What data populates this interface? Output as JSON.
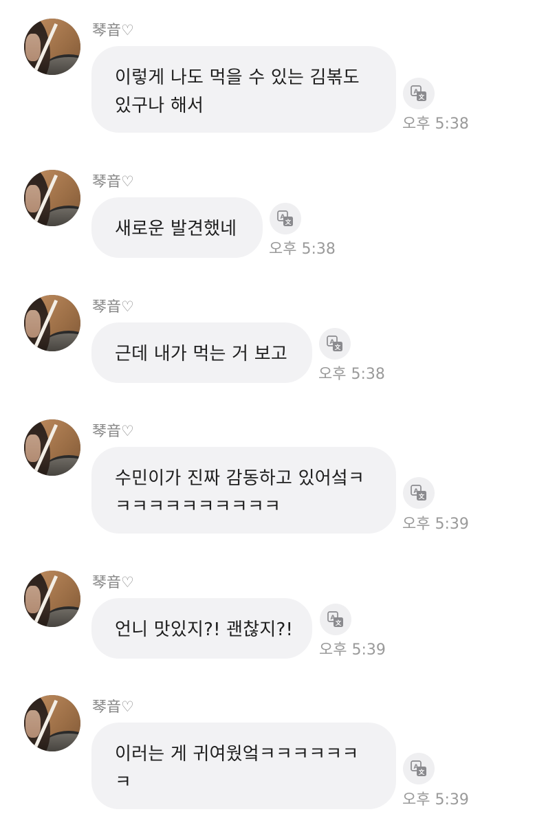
{
  "messages": [
    {
      "sender": "琴音♡",
      "lines": [
        "이렇게 나도 먹을 수 있는 김볶도",
        "있구나 해서"
      ],
      "time": "오후 5:38"
    },
    {
      "sender": "琴音♡",
      "lines": [
        "새로운 발견했네"
      ],
      "time": "오후 5:38"
    },
    {
      "sender": "琴音♡",
      "lines": [
        "근데 내가 먹는 거 보고"
      ],
      "time": "오후 5:38"
    },
    {
      "sender": "琴音♡",
      "lines": [
        "수민이가 진짜 감동하고 있어섴ㅋ",
        "ㅋㅋㅋㅋㅋㅋㅋㅋㅋㅋ"
      ],
      "time": "오후 5:39"
    },
    {
      "sender": "琴音♡",
      "lines": [
        "언니 맛있지?! 괜찮지?!"
      ],
      "time": "오후 5:39"
    },
    {
      "sender": "琴音♡",
      "lines": [
        "이러는 게 귀여웠엌ㅋㅋㅋㅋㅋㅋ",
        "ㅋ"
      ],
      "time": "오후 5:39"
    }
  ],
  "icons": {
    "translate": "translate-icon",
    "avatar": "avatar"
  },
  "colors": {
    "bubble": "#f2f2f4",
    "name": "#858585",
    "time": "#9a9a9a",
    "text": "#1e1e1e"
  }
}
